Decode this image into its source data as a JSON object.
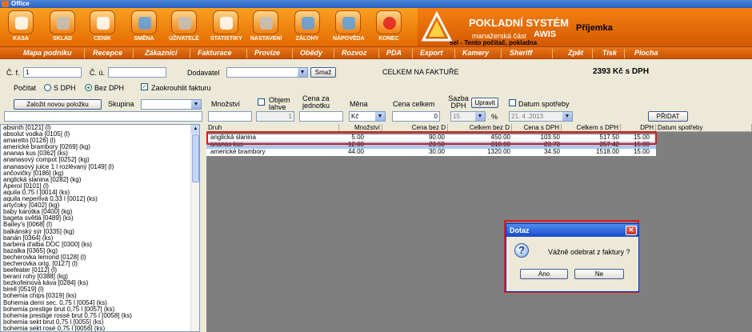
{
  "window": {
    "title": "Office"
  },
  "toolbar": [
    {
      "label": "KASA",
      "icon": "cash-register-icon"
    },
    {
      "label": "SKLAD",
      "icon": "warehouse-icon"
    },
    {
      "label": "CENÍK",
      "icon": "price-list-icon"
    },
    {
      "label": "SMĚNA",
      "icon": "shift-icon"
    },
    {
      "label": "UŽIVATELÉ",
      "icon": "users-icon"
    },
    {
      "label": "STATISTIKY",
      "icon": "statistics-icon"
    },
    {
      "label": "NASTAVENÍ",
      "icon": "settings-tools-icon"
    },
    {
      "label": "ZÁLOHY",
      "icon": "backup-disc-icon"
    },
    {
      "label": "NÁPOVĚDA",
      "icon": "help-icon"
    },
    {
      "label": "KONEC",
      "icon": "exit-icon"
    }
  ],
  "brand": {
    "title": "POKLADNÍ SYSTÉM",
    "subtitle": "manažerská část",
    "name": "AWIS",
    "status": "sel  -  Tento počítač, pokladna",
    "section": "Příjemka"
  },
  "menu": [
    "Mapa podniku",
    "Recepce",
    "Zákazníci",
    "Fakturace",
    "Provize",
    "Obědy",
    "Rozvoz",
    "PDA",
    "Export",
    "Kamery",
    "Sheriff",
    "Zpět",
    "Tisk",
    "Plocha"
  ],
  "form": {
    "cf_label": "Č. f.",
    "cf_value": "1",
    "cu_label": "Č. ú.",
    "cu_value": "",
    "dodavatel_label": "Dodavatel",
    "dodavatel_value": "",
    "smaz_label": "Smaž",
    "total_label": "CELKEM NA FAKTUŘE",
    "total_value": "2393 Kč s DPH",
    "pocitat_label": "Počítat",
    "s_dph_label": "S DPH",
    "bez_dph_label": "Bez DPH",
    "zaokrouhlit_label": "Zaokrouhlit fakturu",
    "new_item_label": "Založit novou položku",
    "skupina_label": "Skupina",
    "mnozstvi_label": "Množství",
    "objem_label": "Objem lahve",
    "objem_value": "1",
    "cena_za_label": "Cena za jednotku",
    "mena_label": "Měna",
    "mena_value": "Kč",
    "cena_celkem_label": "Cena celkem",
    "cena_celkem_value": "0",
    "sazba_label": "Sazba DPH",
    "sazba_value": "15",
    "upravit_label": "Upravit",
    "percent": "%",
    "datum_label": "Datum spotřeby",
    "datum_value": "21. 4 .2013",
    "pridat_label": "PŘIDAT"
  },
  "items": [
    "absinth [0121] (l)",
    "absolut vodka [0105] (l)",
    "amaretto [0126] (l)",
    "americké brambory [0269] (kg)",
    "ananas kus [0362] (ks)",
    "ananasový compot [0252] (kg)",
    "ananasový juice 1 l rozlévaný [0149] (l)",
    "ančovičky [0186] (kg)",
    "anglická slanina [0282] (kg)",
    "Aperol [0101] (l)",
    "aquila 0,75 l [0014] (ks)",
    "aquila neperlivá 0,33 l [0012] (ks)",
    "artyčoky [0402] (kg)",
    "baby karotka [0400] (kg)",
    "bageta světlá [0489] (ks)",
    "Bailey's [0068] (l)",
    "balkánský sýr [0335] (kg)",
    "banán [0364] (ks)",
    "barbera d'alba DOC [0300] (ks)",
    "bazalka [0365] (kg)",
    "becherovka lemond [0128] (l)",
    "becherovka orig. [0127] (l)",
    "beefeater [0112] (l)",
    "beraní rohy [0388] (kg)",
    "bezkofeinová káva [0284] (ks)",
    "birell [0519] (l)",
    "bohemia chips [0319] (ks)",
    "Bohemia demi sec. 0,75 l [0054] (ks)",
    "bohemia prestige brut 0,75 l [0057] (ks)",
    "bohemia prestige rossé brut 0,75 l [0058] (ks)",
    "bohemia sekt brut 0,75 l [0055] (ks)",
    "bohemia sekt rosé 0,75 l [0056] (ks)"
  ],
  "grid": {
    "headers": [
      "Druh",
      "Množství",
      "Cena bez D",
      "Celkem bez D",
      "Cena s DPH",
      "Celkem s DPH",
      "DPH",
      "Datum spotřeby"
    ],
    "rows": [
      [
        "anglická slanina",
        "5.00",
        "90.00",
        "450.00",
        "103.50",
        "517.50",
        "15.00"
      ],
      [
        "ananas kus",
        "12.00",
        "23.50",
        "318.00",
        "23.70",
        "357.42",
        "15.00"
      ],
      [
        "americké brambory",
        "44.00",
        "30.00",
        "1320.00",
        "34.50",
        "1518.00",
        "15.00"
      ]
    ]
  },
  "dialog": {
    "title": "Dotaz",
    "message": "Vážně odebrat z faktury ?",
    "yes_label": "Ano",
    "no_label": "Ne",
    "close": "✕",
    "icon": "?"
  }
}
